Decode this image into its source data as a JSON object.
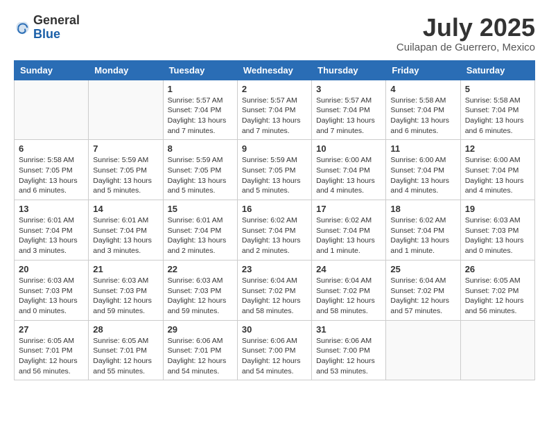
{
  "logo": {
    "general": "General",
    "blue": "Blue"
  },
  "title": "July 2025",
  "subtitle": "Cuilapan de Guerrero, Mexico",
  "days_of_week": [
    "Sunday",
    "Monday",
    "Tuesday",
    "Wednesday",
    "Thursday",
    "Friday",
    "Saturday"
  ],
  "weeks": [
    [
      {
        "day": "",
        "detail": ""
      },
      {
        "day": "",
        "detail": ""
      },
      {
        "day": "1",
        "detail": "Sunrise: 5:57 AM\nSunset: 7:04 PM\nDaylight: 13 hours\nand 7 minutes."
      },
      {
        "day": "2",
        "detail": "Sunrise: 5:57 AM\nSunset: 7:04 PM\nDaylight: 13 hours\nand 7 minutes."
      },
      {
        "day": "3",
        "detail": "Sunrise: 5:57 AM\nSunset: 7:04 PM\nDaylight: 13 hours\nand 7 minutes."
      },
      {
        "day": "4",
        "detail": "Sunrise: 5:58 AM\nSunset: 7:04 PM\nDaylight: 13 hours\nand 6 minutes."
      },
      {
        "day": "5",
        "detail": "Sunrise: 5:58 AM\nSunset: 7:04 PM\nDaylight: 13 hours\nand 6 minutes."
      }
    ],
    [
      {
        "day": "6",
        "detail": "Sunrise: 5:58 AM\nSunset: 7:05 PM\nDaylight: 13 hours\nand 6 minutes."
      },
      {
        "day": "7",
        "detail": "Sunrise: 5:59 AM\nSunset: 7:05 PM\nDaylight: 13 hours\nand 5 minutes."
      },
      {
        "day": "8",
        "detail": "Sunrise: 5:59 AM\nSunset: 7:05 PM\nDaylight: 13 hours\nand 5 minutes."
      },
      {
        "day": "9",
        "detail": "Sunrise: 5:59 AM\nSunset: 7:05 PM\nDaylight: 13 hours\nand 5 minutes."
      },
      {
        "day": "10",
        "detail": "Sunrise: 6:00 AM\nSunset: 7:04 PM\nDaylight: 13 hours\nand 4 minutes."
      },
      {
        "day": "11",
        "detail": "Sunrise: 6:00 AM\nSunset: 7:04 PM\nDaylight: 13 hours\nand 4 minutes."
      },
      {
        "day": "12",
        "detail": "Sunrise: 6:00 AM\nSunset: 7:04 PM\nDaylight: 13 hours\nand 4 minutes."
      }
    ],
    [
      {
        "day": "13",
        "detail": "Sunrise: 6:01 AM\nSunset: 7:04 PM\nDaylight: 13 hours\nand 3 minutes."
      },
      {
        "day": "14",
        "detail": "Sunrise: 6:01 AM\nSunset: 7:04 PM\nDaylight: 13 hours\nand 3 minutes."
      },
      {
        "day": "15",
        "detail": "Sunrise: 6:01 AM\nSunset: 7:04 PM\nDaylight: 13 hours\nand 2 minutes."
      },
      {
        "day": "16",
        "detail": "Sunrise: 6:02 AM\nSunset: 7:04 PM\nDaylight: 13 hours\nand 2 minutes."
      },
      {
        "day": "17",
        "detail": "Sunrise: 6:02 AM\nSunset: 7:04 PM\nDaylight: 13 hours\nand 1 minute."
      },
      {
        "day": "18",
        "detail": "Sunrise: 6:02 AM\nSunset: 7:04 PM\nDaylight: 13 hours\nand 1 minute."
      },
      {
        "day": "19",
        "detail": "Sunrise: 6:03 AM\nSunset: 7:03 PM\nDaylight: 13 hours\nand 0 minutes."
      }
    ],
    [
      {
        "day": "20",
        "detail": "Sunrise: 6:03 AM\nSunset: 7:03 PM\nDaylight: 13 hours\nand 0 minutes."
      },
      {
        "day": "21",
        "detail": "Sunrise: 6:03 AM\nSunset: 7:03 PM\nDaylight: 12 hours\nand 59 minutes."
      },
      {
        "day": "22",
        "detail": "Sunrise: 6:03 AM\nSunset: 7:03 PM\nDaylight: 12 hours\nand 59 minutes."
      },
      {
        "day": "23",
        "detail": "Sunrise: 6:04 AM\nSunset: 7:02 PM\nDaylight: 12 hours\nand 58 minutes."
      },
      {
        "day": "24",
        "detail": "Sunrise: 6:04 AM\nSunset: 7:02 PM\nDaylight: 12 hours\nand 58 minutes."
      },
      {
        "day": "25",
        "detail": "Sunrise: 6:04 AM\nSunset: 7:02 PM\nDaylight: 12 hours\nand 57 minutes."
      },
      {
        "day": "26",
        "detail": "Sunrise: 6:05 AM\nSunset: 7:02 PM\nDaylight: 12 hours\nand 56 minutes."
      }
    ],
    [
      {
        "day": "27",
        "detail": "Sunrise: 6:05 AM\nSunset: 7:01 PM\nDaylight: 12 hours\nand 56 minutes."
      },
      {
        "day": "28",
        "detail": "Sunrise: 6:05 AM\nSunset: 7:01 PM\nDaylight: 12 hours\nand 55 minutes."
      },
      {
        "day": "29",
        "detail": "Sunrise: 6:06 AM\nSunset: 7:01 PM\nDaylight: 12 hours\nand 54 minutes."
      },
      {
        "day": "30",
        "detail": "Sunrise: 6:06 AM\nSunset: 7:00 PM\nDaylight: 12 hours\nand 54 minutes."
      },
      {
        "day": "31",
        "detail": "Sunrise: 6:06 AM\nSunset: 7:00 PM\nDaylight: 12 hours\nand 53 minutes."
      },
      {
        "day": "",
        "detail": ""
      },
      {
        "day": "",
        "detail": ""
      }
    ]
  ]
}
